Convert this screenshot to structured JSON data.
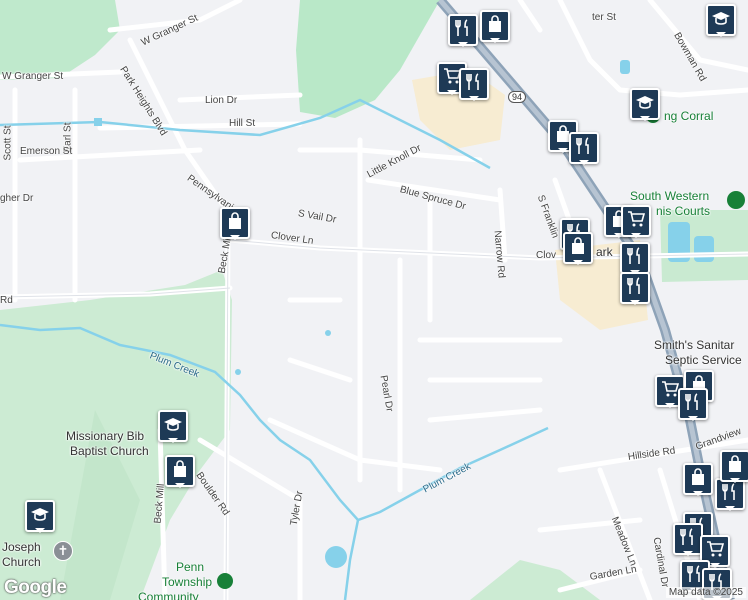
{
  "map": {
    "attribution": "Map data ©2025",
    "logo": "Google",
    "route_shield": "94"
  },
  "streets": {
    "w_granger_st_1": "W Granger St",
    "w_granger_st_2": "W Granger St",
    "park_heights_blvd": "Park Heights Blvd",
    "lion_dr": "Lion Dr",
    "hill_st": "Hill St",
    "scott_st": "Scott St",
    "earl_st": "Earl St",
    "emerson_st": "Emerson St",
    "pennsylvania": "Pennsylvania",
    "gher_dr": "gher Dr",
    "s_vail_dr": "S Vail Dr",
    "clover_ln": "Clover Ln",
    "clover_ln_east": "Clov",
    "beck_mill_rd": "Beck Mill Rd",
    "little_knoll_dr": "Little Knoll Dr",
    "blue_spruce_dr": "Blue Spruce Dr",
    "narrow_rd": "Narrow Rd",
    "s_franklin": "S Franklin",
    "pearl_dr": "Pearl Dr",
    "boulder_rd": "Boulder Rd",
    "tyler_dr": "Tyler Dr",
    "beck_mill_lower": "Beck Mill",
    "hillside_rd": "Hillside Rd",
    "meadow_ln": "Meadow Ln",
    "cardinal_dr": "Cardinal Dr",
    "garden_ln": "Garden Ln",
    "bowman_rd": "Bowman Rd",
    "ter_st": "ter St",
    "rd_west": "Rd",
    "grandview": "Grandview",
    "ark": "ark"
  },
  "water": {
    "plum_creek_1": "Plum Creek",
    "plum_creek_2": "Plum Creek"
  },
  "places": {
    "corral": "ng Corral",
    "south_western_1": "South Western",
    "south_western_2": "nis Courts",
    "smiths_1": "Smith's Sanitar",
    "smiths_2": "Septic Service",
    "missionary_1": "Missionary Bib",
    "missionary_2": "Baptist Church",
    "joseph_1": "Joseph",
    "joseph_2": "Church",
    "penn_1": "Penn",
    "penn_2": "Township",
    "penn_3": "Community"
  },
  "pin_icons": {
    "restaurant": "fork-knife-icon",
    "shopping": "shopping-bag-icon",
    "grocery": "shopping-cart-icon",
    "school": "graduation-cap-icon"
  },
  "colors": {
    "land": "#f1f2f5",
    "park": "#b9e8c8",
    "forest": "#ccebd3",
    "water": "#86d1ea",
    "road": "#ffffff",
    "highway": "#8ea3b8",
    "commercial": "#f7ecd2",
    "pin": "#1e3a56"
  }
}
